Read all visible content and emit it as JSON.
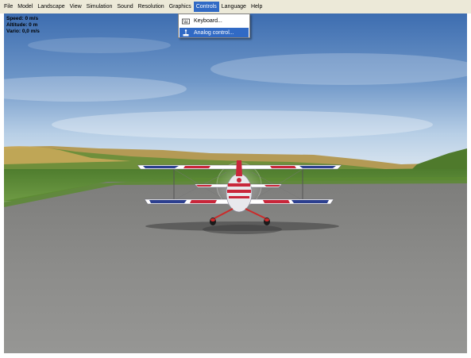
{
  "menubar": {
    "items": [
      {
        "label": "File"
      },
      {
        "label": "Model"
      },
      {
        "label": "Landscape"
      },
      {
        "label": "View"
      },
      {
        "label": "Simulation"
      },
      {
        "label": "Sound"
      },
      {
        "label": "Resolution"
      },
      {
        "label": "Graphics"
      },
      {
        "label": "Controls"
      },
      {
        "label": "Language"
      },
      {
        "label": "Help"
      }
    ]
  },
  "hud": {
    "speed": "Speed: 0 m/s",
    "altitude": "Altitude: 0 m",
    "vario": "Vario: 0,0 m/s"
  },
  "controls_menu": {
    "items": [
      {
        "label": "Keyboard...",
        "icon": "keyboard-icon"
      },
      {
        "label": "Analog control...",
        "icon": "joystick-icon"
      }
    ]
  },
  "colors": {
    "menubar_bg": "#ece9d8",
    "highlight": "#316ac5",
    "sky_top": "#3f6fb3",
    "sky_horizon": "#c7d9ea",
    "grass": "#5f8f38",
    "runway": "#8a8a8a"
  }
}
